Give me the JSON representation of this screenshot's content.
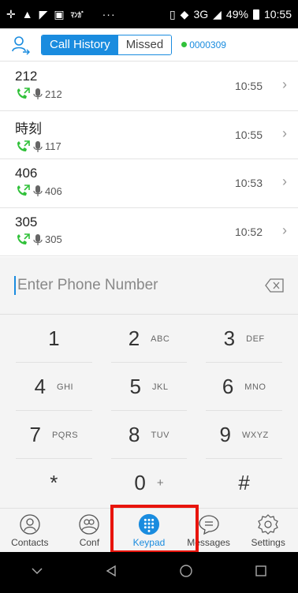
{
  "status_bar": {
    "dots": "···",
    "network": "3G",
    "battery": "49%",
    "time": "10:55"
  },
  "header": {
    "tabs": [
      {
        "label": "Call History",
        "active": true
      },
      {
        "label": "Missed",
        "active": false
      }
    ],
    "account": "0000309"
  },
  "history": [
    {
      "name": "212",
      "number": "212",
      "time": "10:55"
    },
    {
      "name": "時刻",
      "number": "117",
      "time": "10:55"
    },
    {
      "name": "406",
      "number": "406",
      "time": "10:53"
    },
    {
      "name": "305",
      "number": "305",
      "time": "10:52"
    }
  ],
  "dialer": {
    "placeholder": "Enter Phone Number",
    "keys": [
      {
        "num": "1",
        "letters": ""
      },
      {
        "num": "2",
        "letters": "ABC"
      },
      {
        "num": "3",
        "letters": "DEF"
      },
      {
        "num": "4",
        "letters": "GHI"
      },
      {
        "num": "5",
        "letters": "JKL"
      },
      {
        "num": "6",
        "letters": "MNO"
      },
      {
        "num": "7",
        "letters": "PQRS"
      },
      {
        "num": "8",
        "letters": "TUV"
      },
      {
        "num": "9",
        "letters": "WXYZ"
      },
      {
        "num": "*",
        "letters": ""
      },
      {
        "num": "0",
        "letters": "+"
      },
      {
        "num": "#",
        "letters": ""
      }
    ]
  },
  "tabs": [
    {
      "label": "Contacts",
      "icon": "contacts-icon"
    },
    {
      "label": "Conf",
      "icon": "conference-icon"
    },
    {
      "label": "Keypad",
      "icon": "keypad-icon",
      "active": true
    },
    {
      "label": "Messages",
      "icon": "messages-icon"
    },
    {
      "label": "Settings",
      "icon": "settings-icon"
    }
  ],
  "colors": {
    "accent": "#1a8cdf",
    "call_green": "#31c13a",
    "highlight": "#e8140c"
  }
}
